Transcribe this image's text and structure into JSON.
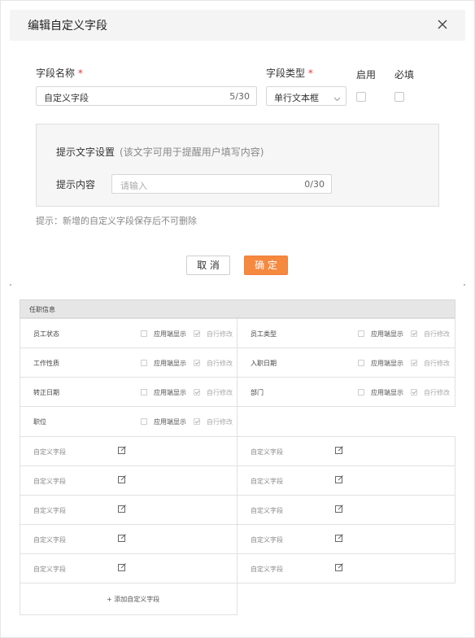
{
  "dialog": {
    "title": "编辑自定义字段",
    "close_icon": "close-icon"
  },
  "form": {
    "field_name_label": "字段名称",
    "field_name_value": "自定义字段",
    "field_name_count": "5/30",
    "field_type_label": "字段类型",
    "field_type_value": "单行文本框",
    "enable_label": "启用",
    "required_label": "必填",
    "required_mark": "*",
    "enable_checked": false,
    "required_checked": false
  },
  "hint_box": {
    "title": "提示文字设置",
    "subtitle": "(该文字可用于提醒用户填写内容)",
    "content_label": "提示内容",
    "content_placeholder": "请输入",
    "content_count": "0/30"
  },
  "tip": "提示：新增的自定义字段保存后不可删除",
  "buttons": {
    "cancel": "取 消",
    "confirm": "确 定"
  },
  "colors": {
    "accent": "#f58940",
    "required": "#e53935"
  },
  "background_form": {
    "section_title": "任职信息",
    "option_display": "应用端显示",
    "option_editable": "自行修改",
    "fields": [
      {
        "label": "员工状态"
      },
      {
        "label": "员工类型"
      },
      {
        "label": "工作性质"
      },
      {
        "label": "入职日期"
      },
      {
        "label": "转正日期"
      },
      {
        "label": "部门"
      },
      {
        "label": "职位"
      }
    ],
    "custom_field_label": "自定义字段",
    "custom_icon": "edit-icon",
    "add_field": "+ 添加自定义字段"
  }
}
